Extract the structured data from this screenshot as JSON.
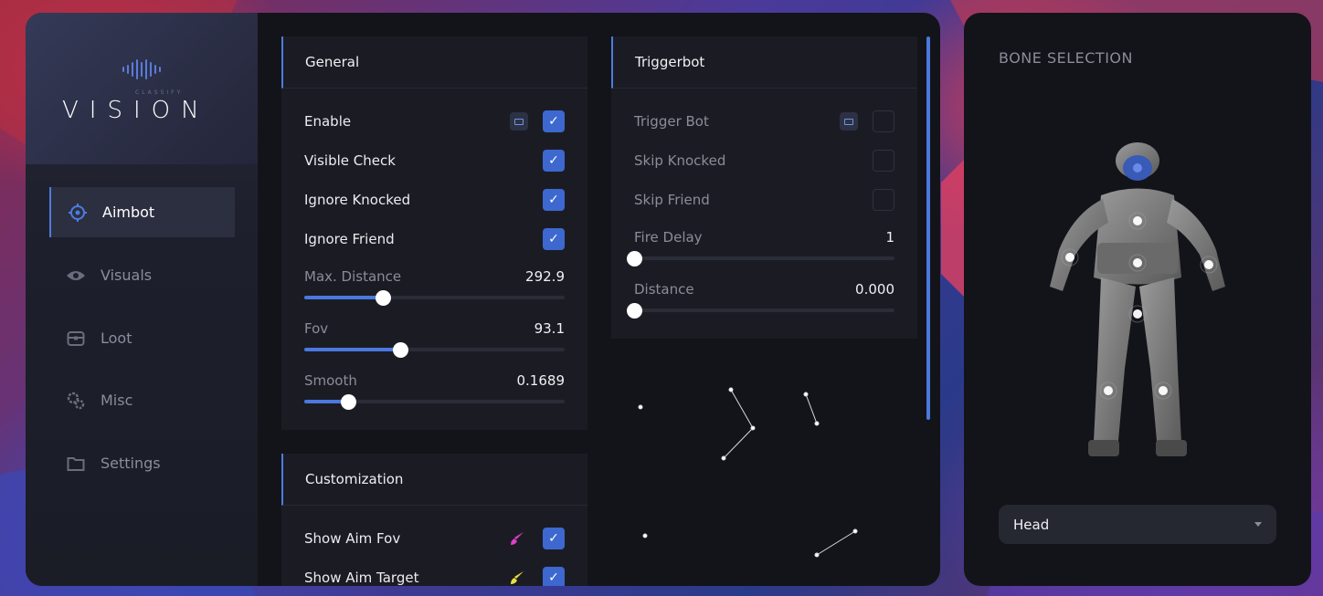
{
  "logo": {
    "subtitle": "CLASSIFY",
    "title": "VISION"
  },
  "sidebar": {
    "items": [
      {
        "label": "Aimbot",
        "icon": "crosshair-icon",
        "active": true
      },
      {
        "label": "Visuals",
        "icon": "eye-icon",
        "active": false
      },
      {
        "label": "Loot",
        "icon": "chest-icon",
        "active": false
      },
      {
        "label": "Misc",
        "icon": "gears-icon",
        "active": false
      },
      {
        "label": "Settings",
        "icon": "folder-icon",
        "active": false
      }
    ]
  },
  "general": {
    "title": "General",
    "enable": {
      "label": "Enable",
      "checked": true
    },
    "visible_check": {
      "label": "Visible Check",
      "checked": true
    },
    "ignore_knocked": {
      "label": "Ignore Knocked",
      "checked": true
    },
    "ignore_friend": {
      "label": "Ignore Friend",
      "checked": true
    },
    "max_distance": {
      "label": "Max. Distance",
      "value": "292.9",
      "fill": 0.3
    },
    "fov": {
      "label": "Fov",
      "value": "93.1",
      "fill": 0.37
    },
    "smooth": {
      "label": "Smooth",
      "value": "0.1689",
      "fill": 0.17
    }
  },
  "customization": {
    "title": "Customization",
    "show_aim_fov": {
      "label": "Show Aim Fov",
      "checked": true,
      "color": "#e040c8"
    },
    "show_aim_target": {
      "label": "Show Aim Target",
      "checked": true,
      "color": "#e8e040"
    }
  },
  "triggerbot": {
    "title": "Triggerbot",
    "trigger_bot": {
      "label": "Trigger Bot",
      "checked": false
    },
    "skip_knocked": {
      "label": "Skip Knocked",
      "checked": false
    },
    "skip_friend": {
      "label": "Skip Friend",
      "checked": false
    },
    "fire_delay": {
      "label": "Fire Delay",
      "value": "1",
      "fill": 0
    },
    "distance": {
      "label": "Distance",
      "value": "0.000",
      "fill": 0
    }
  },
  "bone_selection": {
    "title": "BONE SELECTION",
    "selected": "Head"
  },
  "colors": {
    "accent": "#4a78de",
    "panel": "#131419",
    "card": "#1b1c23"
  }
}
